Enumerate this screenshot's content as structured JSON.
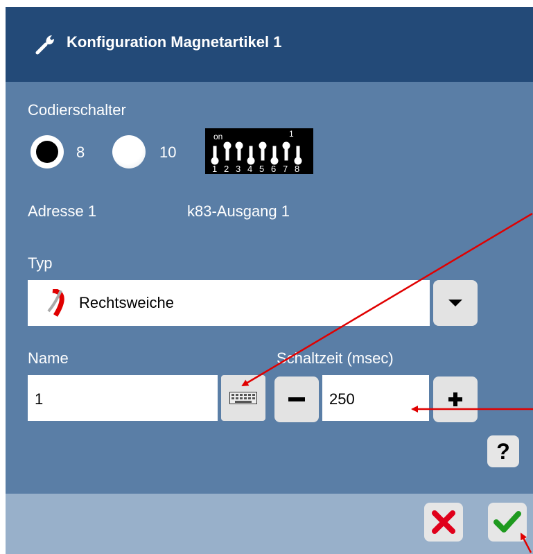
{
  "dialog": {
    "title": "Konfiguration Magnetartikel 1",
    "codier_label": "Codierschalter",
    "options": [
      {
        "label": "8",
        "selected": true
      },
      {
        "label": "10",
        "selected": false
      }
    ],
    "dip_switch": {
      "top_on": "on",
      "top_one": "1",
      "numbers": [
        "1",
        "2",
        "3",
        "4",
        "5",
        "6",
        "7",
        "8"
      ],
      "icon": "dip-switch-icon"
    },
    "address_label": "Adresse 1",
    "output_label": "k83-Ausgang 1",
    "typ_label": "Typ",
    "typ_value": "Rechtsweiche",
    "name_label": "Name",
    "name_value": "1",
    "schaltzeit_label": "Schaltzeit (msec)",
    "schaltzeit_value": "250",
    "minus_label": "−",
    "plus_label": "+",
    "help_label": "?",
    "colors": {
      "titlebar": "#234a78",
      "body": "#5a7ea6",
      "footer": "#98b0ca",
      "cancel": "#e0001b",
      "ok": "#1f9a1f",
      "annotation": "#e00000"
    }
  }
}
